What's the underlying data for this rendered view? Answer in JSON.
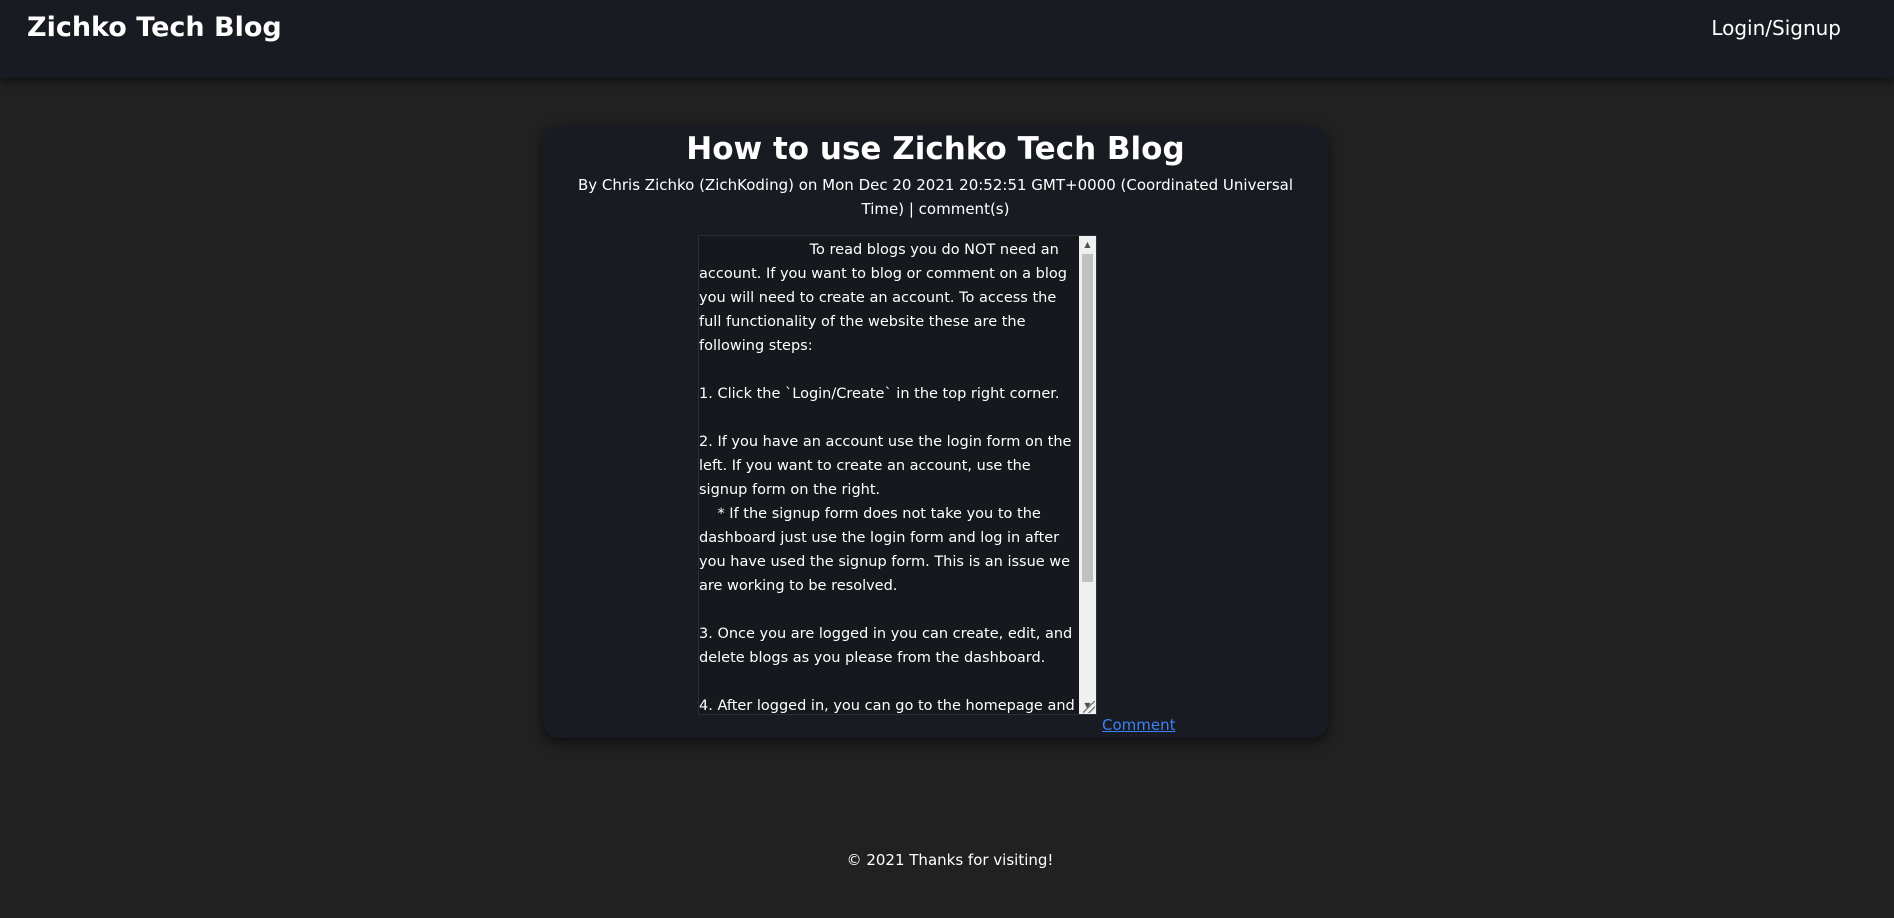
{
  "header": {
    "site_title": "Zichko Tech Blog",
    "login_label": "Login/Signup"
  },
  "post": {
    "title": "How to use Zichko Tech Blog",
    "meta": "By Chris Zichko (ZichKoding) on Mon Dec 20 2021 20:52:51 GMT+0000 (Coordinated Universal Time) | comment(s)",
    "body": "                        To read blogs you do NOT need an account. If you want to blog or comment on a blog you will need to create an account. To access the full functionality of the website these are the following steps:\n\n1. Click the `Login/Create` in the top right corner.\n\n2. If you have an account use the login form on the left. If you want to create an account, use the signup form on the right.\n    * If the signup form does not take you to the dashboard just use the login form and log in after you have used the signup form. This is an issue we are working to be resolved.\n\n3. Once you are logged in you can create, edit, and delete blogs as you please from the dashboard.\n\n4. After logged in, you can go to the homepage and",
    "comment_link": "Comment"
  },
  "footer": {
    "text": "© 2021 Thanks for visiting!"
  },
  "icons": {
    "scroll_up": "scroll-up-arrow-icon",
    "scroll_down": "scroll-down-arrow-icon",
    "resize": "resize-grip-icon"
  },
  "colors": {
    "page_bg": "#212122",
    "card_bg": "#181b21",
    "link": "#3b82f6"
  }
}
